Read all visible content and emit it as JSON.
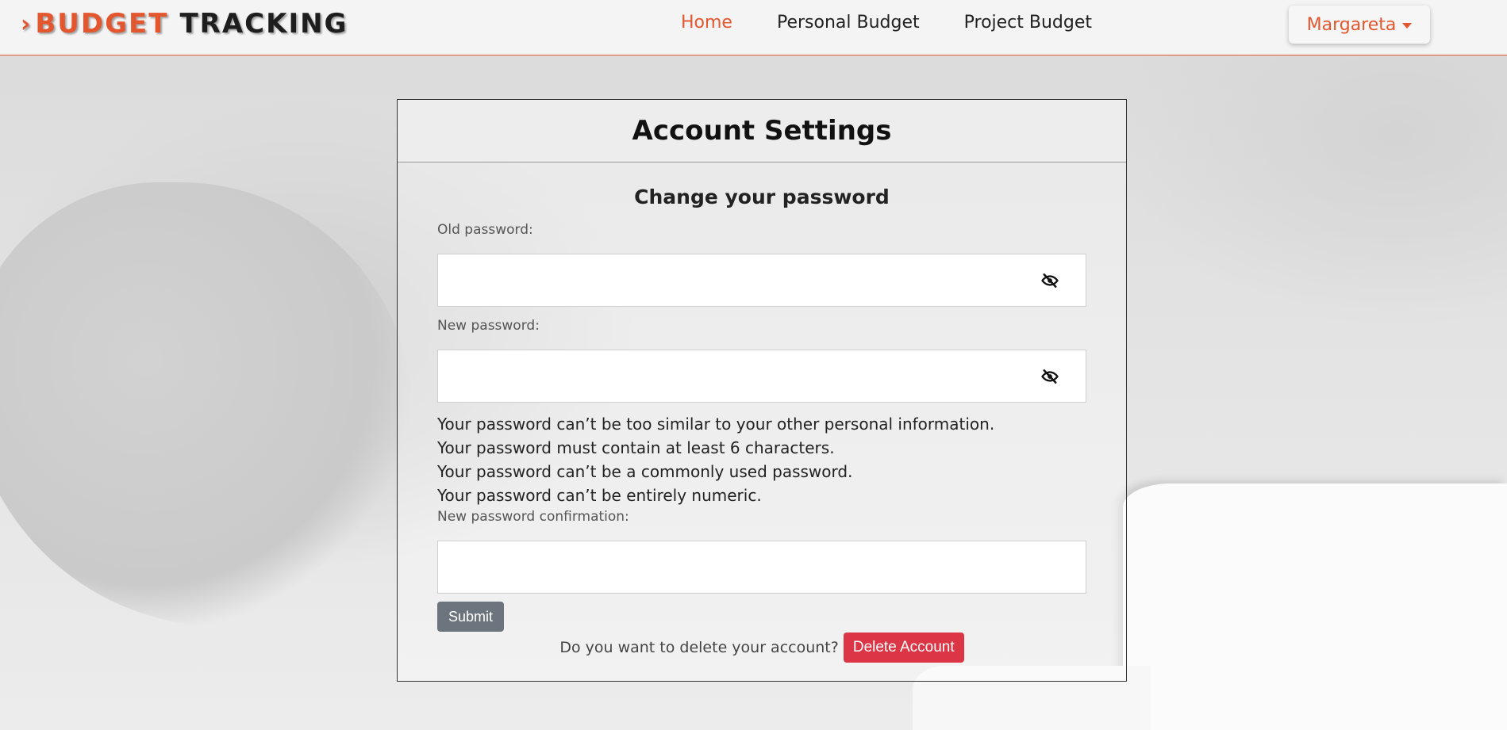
{
  "nav": {
    "brand_part1": "BUDGET",
    "brand_part2": "TRACKING",
    "links": [
      {
        "label": "Home",
        "active": true
      },
      {
        "label": "Personal Budget",
        "active": false
      },
      {
        "label": "Project Budget",
        "active": false
      }
    ],
    "user": "Margareta"
  },
  "card": {
    "title": "Account Settings",
    "section_title": "Change your password",
    "old_password_label": "Old password:",
    "old_password_value": "",
    "new_password_label": "New password:",
    "new_password_value": "",
    "help": [
      "Your password can’t be too similar to your other personal information.",
      "Your password must contain at least 6 characters.",
      "Your password can’t be a commonly used password.",
      "Your password can’t be entirely numeric."
    ],
    "confirm_label": "New password confirmation:",
    "confirm_value": "",
    "submit_label": "Submit",
    "delete_question": "Do you want to delete your account?",
    "delete_label": "Delete Account"
  },
  "colors": {
    "accent": "#e4572e",
    "danger": "#dc3545",
    "secondary": "#6c757d"
  },
  "icons": [
    "eye-slash-icon",
    "caret-down-icon",
    "chevron-right-icon"
  ]
}
